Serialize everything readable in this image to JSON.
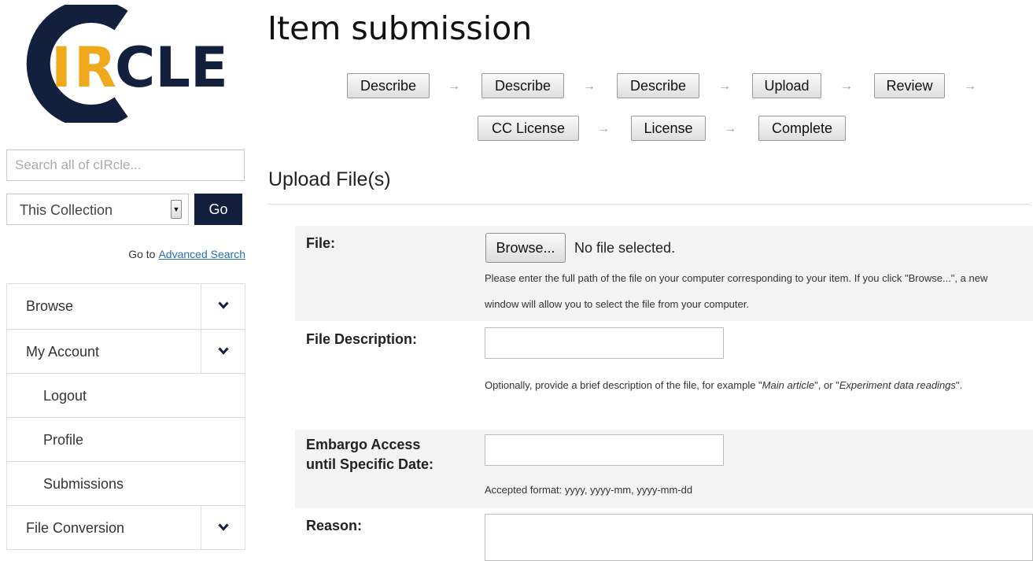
{
  "logo": {
    "text_c": "C",
    "text_ir": "IR",
    "text_cle": "CLE",
    "colors": {
      "navy": "#13203d",
      "gold": "#f0a81c"
    }
  },
  "search": {
    "placeholder": "Search all of cIRcle..."
  },
  "scope": {
    "selected": "This Collection"
  },
  "go_label": "Go",
  "goto": {
    "prefix": "Go to",
    "link": "Advanced Search"
  },
  "sidebar": {
    "items": [
      {
        "label": "Browse",
        "expandable": true
      },
      {
        "label": "My Account",
        "expandable": true
      },
      {
        "label": "Logout",
        "expandable": false
      },
      {
        "label": "Profile",
        "expandable": false
      },
      {
        "label": "Submissions",
        "expandable": false
      },
      {
        "label": "File Conversion",
        "expandable": true
      }
    ],
    "toggle_icon": "chevron-down-icon"
  },
  "page_title": "Item submission",
  "steps": [
    "Describe",
    "Describe",
    "Describe",
    "Upload",
    "Review",
    "CC License",
    "License",
    "Complete"
  ],
  "step_separator": "→",
  "section_title": "Upload File(s)",
  "form": {
    "file": {
      "label": "File:",
      "browse_label": "Browse...",
      "status": "No file selected.",
      "help": "Please enter the full path of the file on your computer corresponding to your item. If you click \"Browse...\", a new window will allow you to select the file from your computer."
    },
    "description": {
      "label": "File Description:",
      "value": "",
      "help_prefix": "Optionally, provide a brief description of the file, for example \"",
      "help_example1": "Main article",
      "help_middle": "\", or \"",
      "help_example2": "Experiment data readings",
      "help_suffix": "\"."
    },
    "embargo": {
      "label_line1": "Embargo Access",
      "label_line2": "until Specific Date:",
      "value": "",
      "help": "Accepted format: yyyy, yyyy-mm, yyyy-mm-dd"
    },
    "reason": {
      "label": "Reason:",
      "value": ""
    }
  }
}
